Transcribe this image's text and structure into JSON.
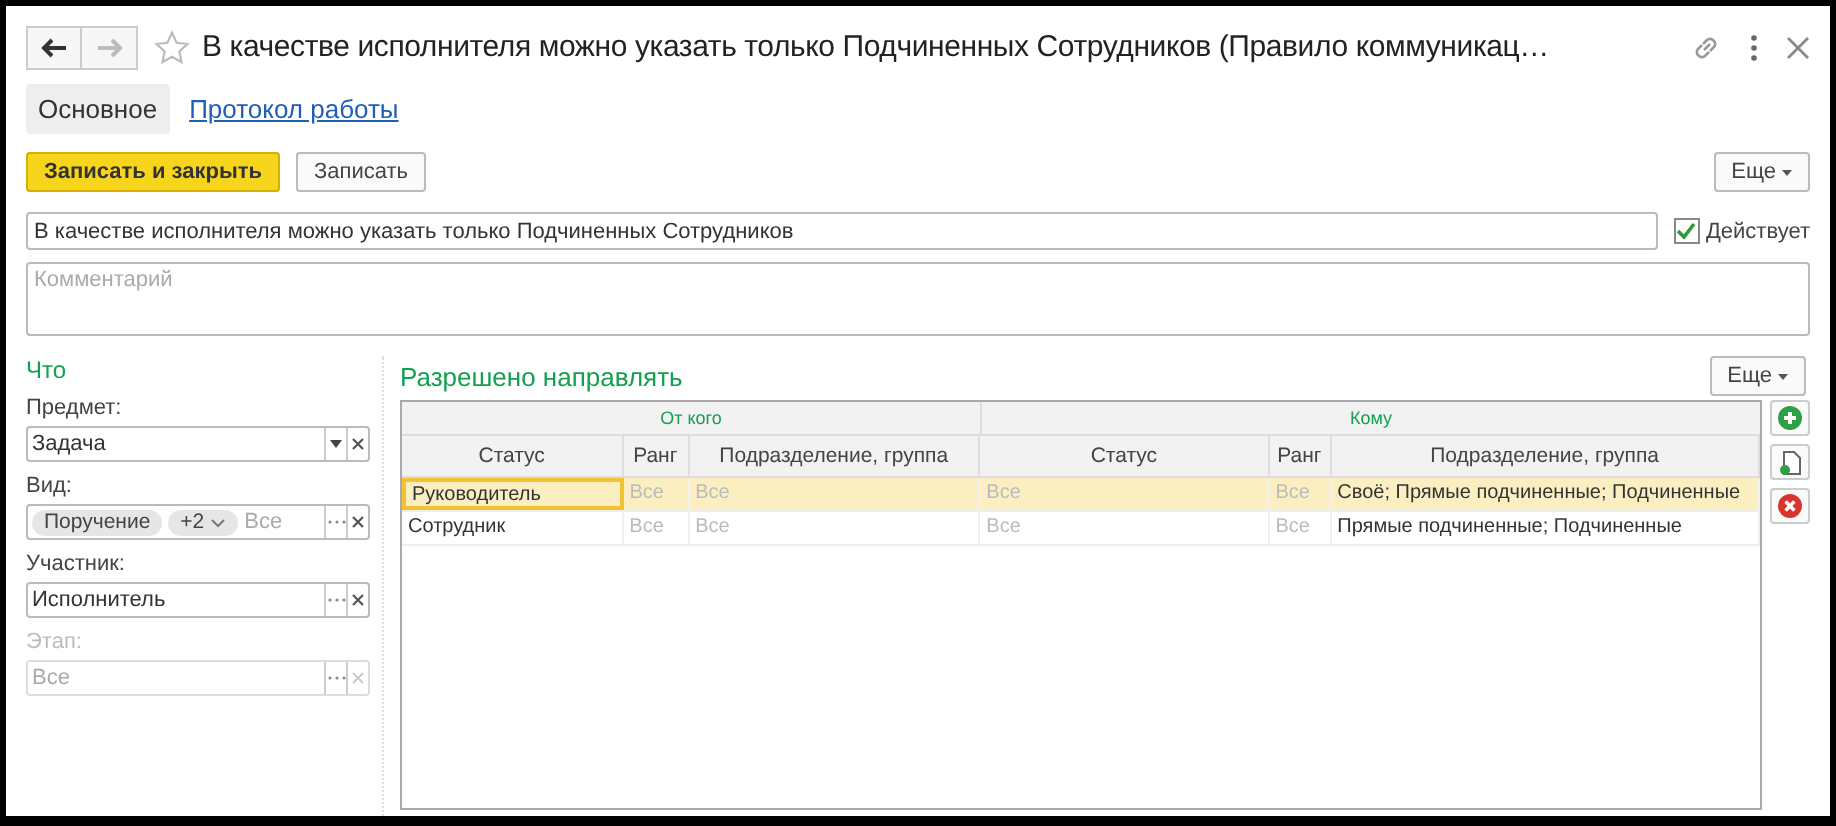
{
  "window": {
    "title": "В качестве исполнителя можно указать только Подчиненных Сотрудников (Правило коммуникац…",
    "favorite": false
  },
  "tabs": [
    {
      "label": "Основное",
      "selected": true
    },
    {
      "label": "Протокол работы",
      "selected": false
    }
  ],
  "toolbar": {
    "primary": "Записать и закрыть",
    "secondary": "Записать",
    "more": "Еще"
  },
  "name_field": {
    "value": "В качестве исполнителя можно указать только Подчиненных Сотрудников"
  },
  "active": {
    "label": "Действует",
    "checked": true
  },
  "comment": {
    "placeholder": "Комментарий"
  },
  "what": {
    "title": "Что",
    "fields": [
      {
        "label": "Предмет:",
        "value": "Задача",
        "kind": "dropdown",
        "disabled": false
      },
      {
        "label": "Вид:",
        "tags": [
          "Поручение"
        ],
        "more_tag": "+2",
        "placeholder": "Все",
        "kind": "select",
        "disabled": false
      },
      {
        "label": "Участник:",
        "value": "Исполнитель",
        "kind": "select",
        "disabled": false
      },
      {
        "label": "Этап:",
        "placeholder": "Все",
        "kind": "select",
        "disabled": true
      }
    ]
  },
  "allowed": {
    "title": "Разрешено направлять",
    "more": "Еще",
    "groups": [
      "От кого",
      "Кому"
    ],
    "columns": [
      "Статус",
      "Ранг",
      "Подразделение, группа",
      "Статус",
      "Ранг",
      "Подразделение, группа"
    ],
    "rows": [
      {
        "selected": true,
        "cells": [
          {
            "text": "Руководитель",
            "muted": false
          },
          {
            "text": "Все",
            "muted": true
          },
          {
            "text": "Все",
            "muted": true
          },
          {
            "text": "Все",
            "muted": true
          },
          {
            "text": "Все",
            "muted": true
          },
          {
            "text": "Своё; Прямые подчиненные; Подчиненные",
            "muted": false
          }
        ]
      },
      {
        "selected": false,
        "cells": [
          {
            "text": "Сотрудник",
            "muted": false
          },
          {
            "text": "Все",
            "muted": true
          },
          {
            "text": "Все",
            "muted": true
          },
          {
            "text": "Все",
            "muted": true
          },
          {
            "text": "Все",
            "muted": true
          },
          {
            "text": "Прямые подчиненные; Подчиненные",
            "muted": false
          }
        ]
      }
    ]
  }
}
